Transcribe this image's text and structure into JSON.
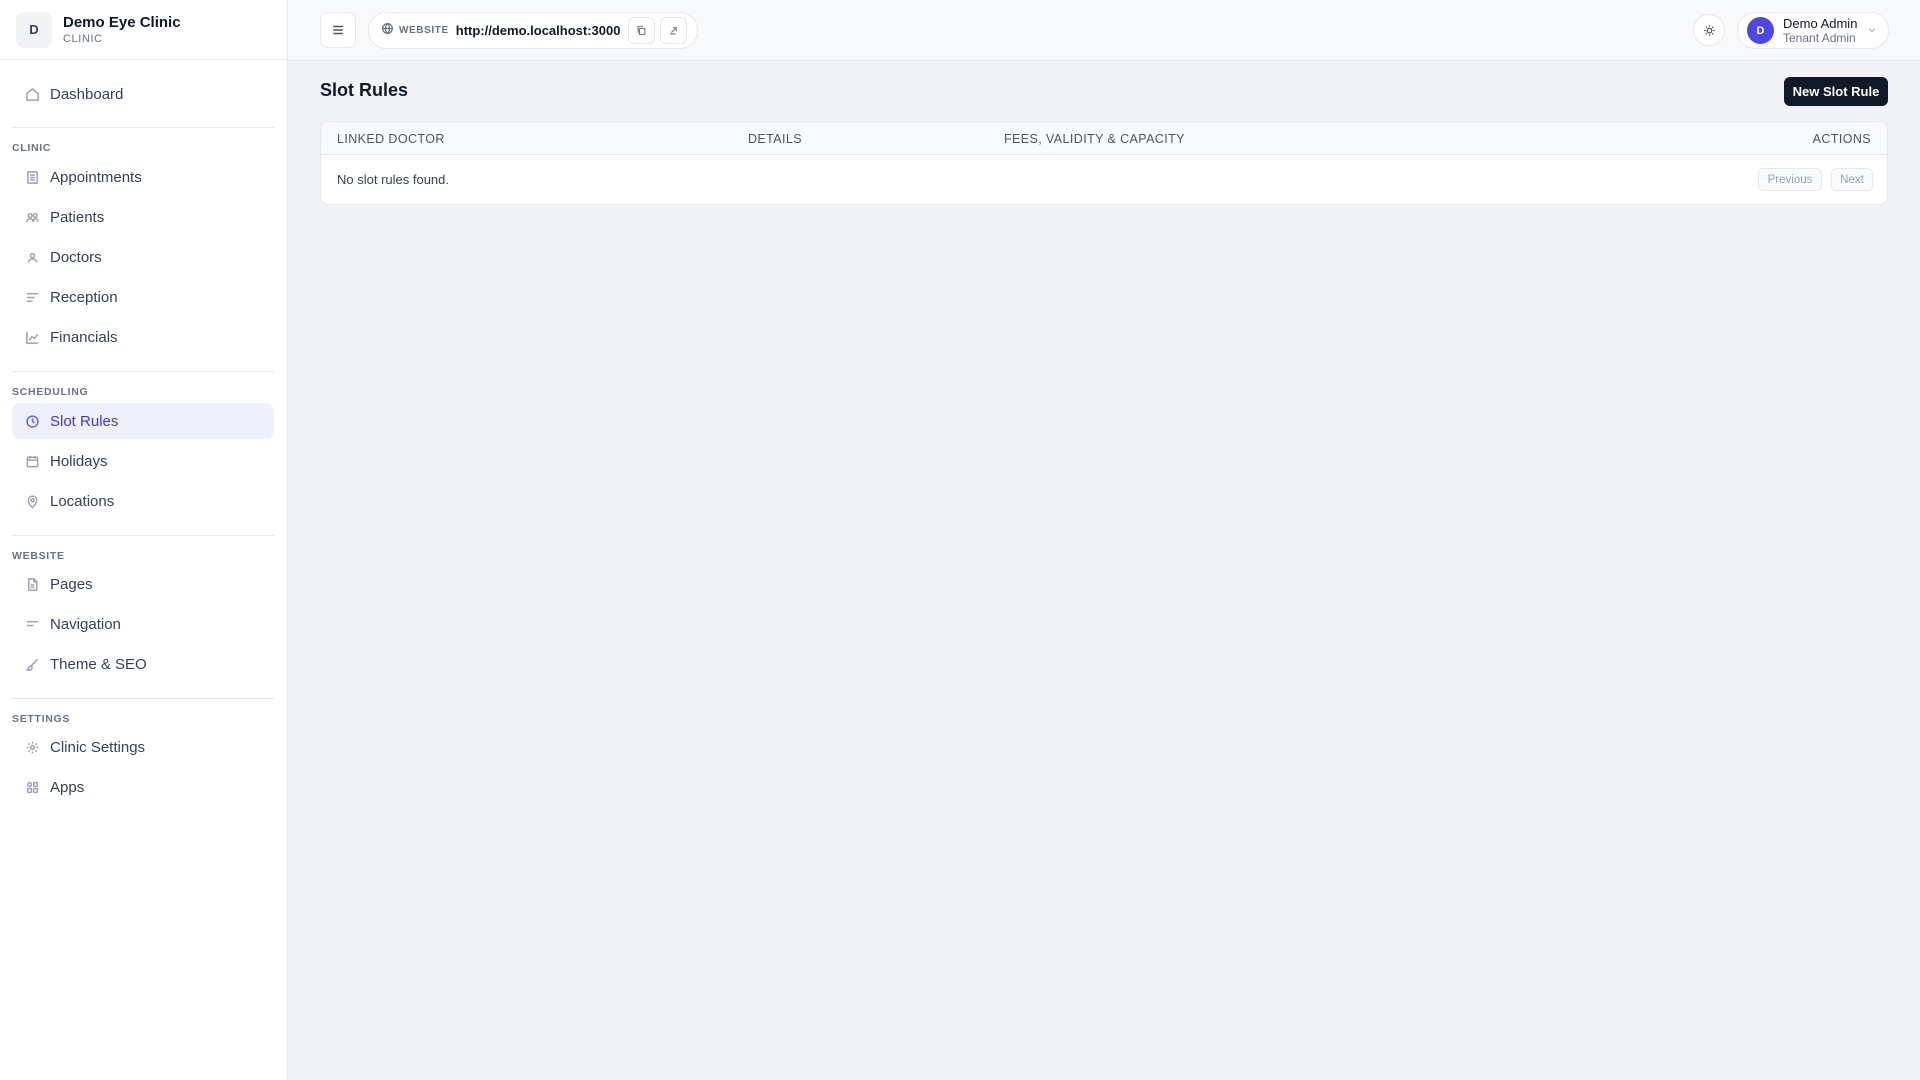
{
  "brand": {
    "initial": "D",
    "name": "Demo Eye Clinic",
    "subtitle": "CLINIC"
  },
  "sidebar": {
    "dashboard": "Dashboard",
    "sections": {
      "clinic": "CLINIC",
      "scheduling": "SCHEDULING",
      "website": "WEBSITE",
      "settings": "SETTINGS"
    },
    "items": {
      "appointments": "Appointments",
      "patients": "Patients",
      "doctors": "Doctors",
      "reception": "Reception",
      "financials": "Financials",
      "slot_rules": "Slot Rules",
      "holidays": "Holidays",
      "locations": "Locations",
      "pages": "Pages",
      "navigation": "Navigation",
      "theme_seo": "Theme & SEO",
      "clinic_settings": "Clinic Settings",
      "apps": "Apps"
    },
    "active": "slot_rules"
  },
  "topbar": {
    "website_label": "WEBSITE",
    "website_url": "http://demo.localhost:3000",
    "user": {
      "initial": "D",
      "name": "Demo Admin",
      "role": "Tenant Admin"
    }
  },
  "main": {
    "title": "Slot Rules",
    "new_button": "New Slot Rule",
    "table": {
      "columns": [
        "LINKED DOCTOR",
        "DETAILS",
        "FEES, VALIDITY & CAPACITY",
        "ACTIONS"
      ],
      "empty_message": "No slot rules found.",
      "previous": "Previous",
      "next": "Next"
    }
  },
  "colors": {
    "accent": "#4f46e5",
    "active_bg": "#eef0fb",
    "primary_button": "#111827"
  }
}
